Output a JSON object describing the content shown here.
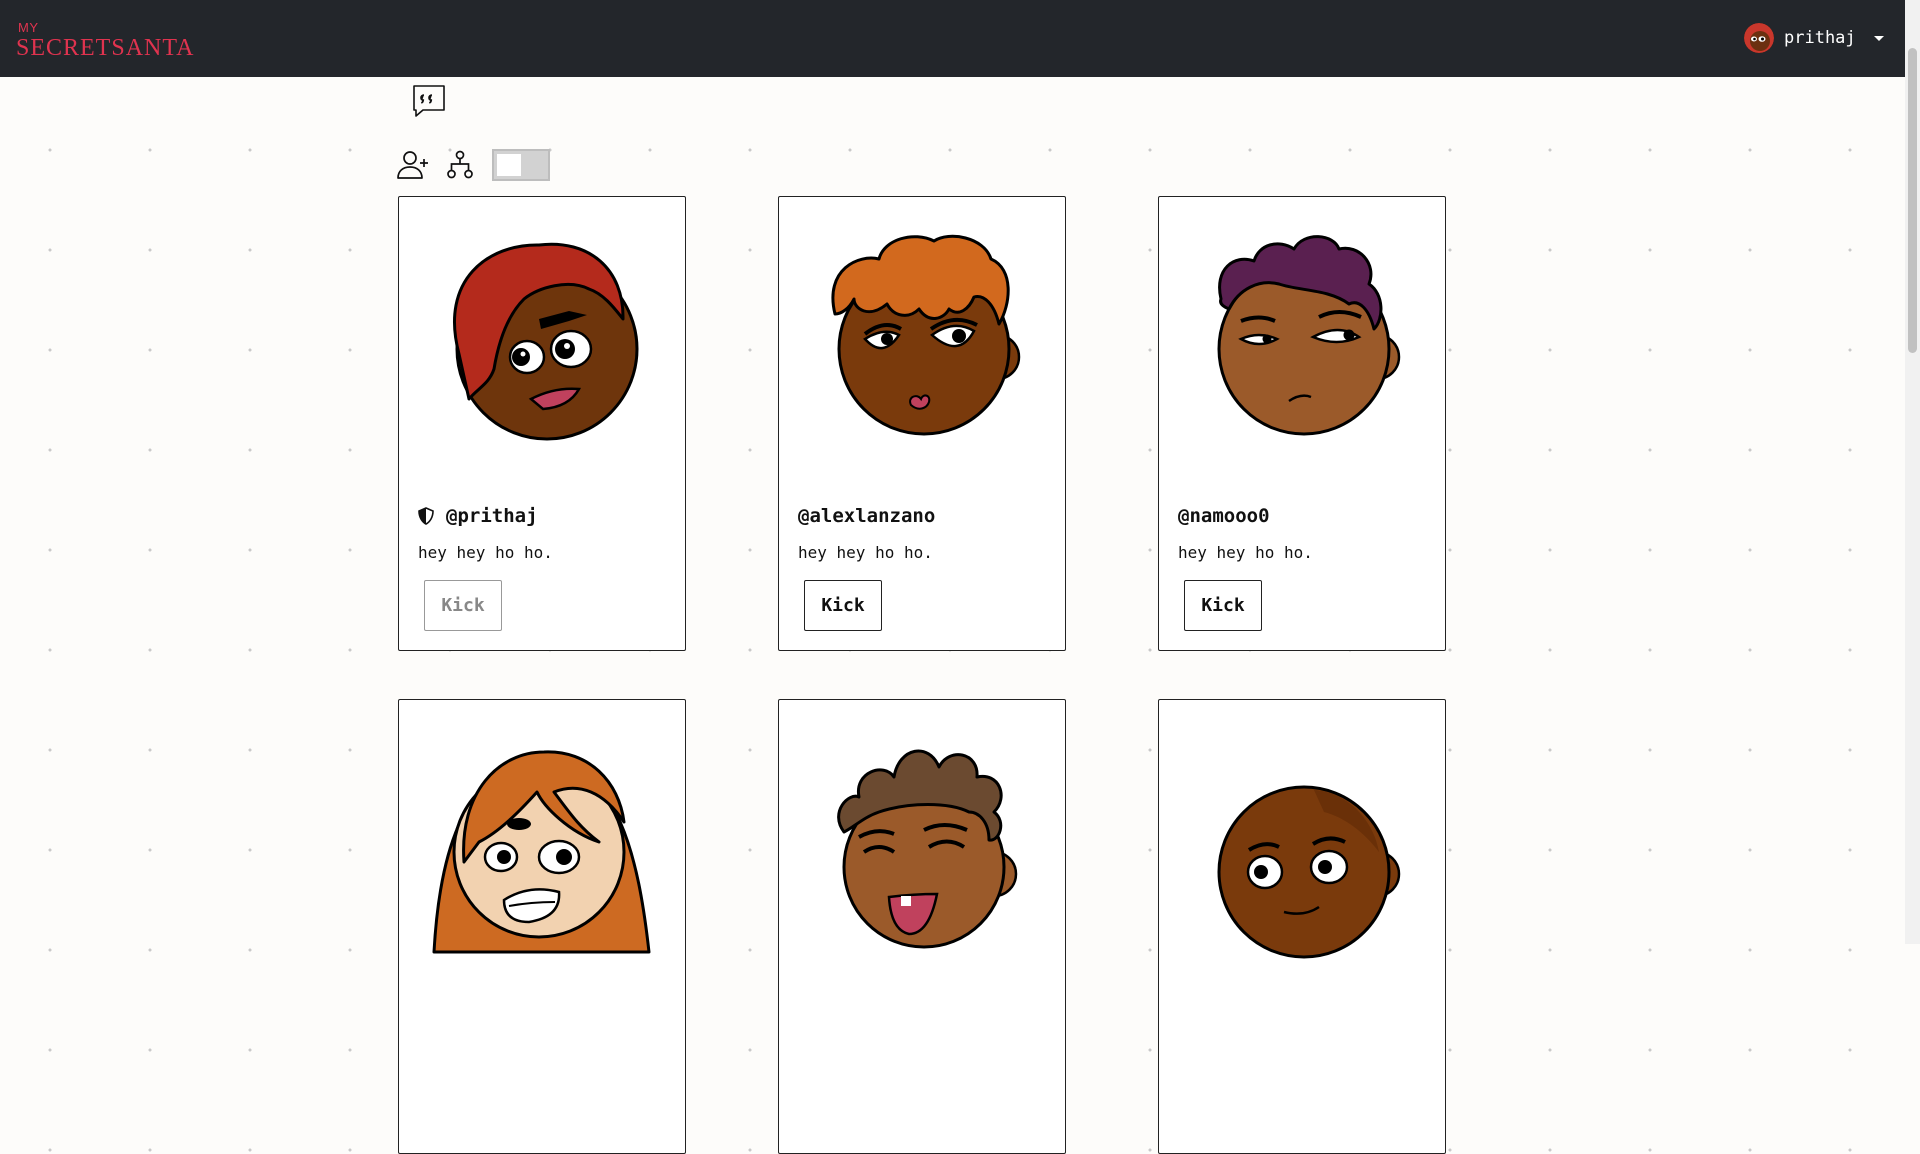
{
  "app": {
    "logo_small": "MY",
    "logo_main": "SECRETSANTA"
  },
  "user": {
    "username": "prithaj"
  },
  "toolbar": {
    "quote_icon": "quote-bubble-icon",
    "add_user_icon": "add-user-icon",
    "hierarchy_icon": "hierarchy-icon",
    "toggle_on": false
  },
  "members": [
    {
      "handle": "@prithaj",
      "bio": "hey hey ho ho.",
      "kick_label": "Kick",
      "is_admin": true,
      "kick_disabled": true,
      "skin": "#7a3a10",
      "hair": "#b42a1c"
    },
    {
      "handle": "@alexlanzano",
      "bio": "hey hey ho ho.",
      "kick_label": "Kick",
      "is_admin": false,
      "kick_disabled": false,
      "skin": "#7a3a0c",
      "hair": "#d2691e"
    },
    {
      "handle": "@namooo0",
      "bio": "hey hey ho ho.",
      "kick_label": "Kick",
      "is_admin": false,
      "kick_disabled": false,
      "skin": "#9b5a2a",
      "hair": "#5a2050"
    },
    {
      "handle": "",
      "bio": "",
      "kick_label": "",
      "is_admin": false,
      "kick_disabled": false,
      "skin": "#f2d2b0",
      "hair": "#cd6a22"
    },
    {
      "handle": "",
      "bio": "",
      "kick_label": "",
      "is_admin": false,
      "kick_disabled": false,
      "skin": "#9b5a2a",
      "hair": "#6b4a30"
    },
    {
      "handle": "",
      "bio": "",
      "kick_label": "",
      "is_admin": false,
      "kick_disabled": false,
      "skin": "#7a3a0c",
      "hair": "#7a3a0c"
    }
  ]
}
